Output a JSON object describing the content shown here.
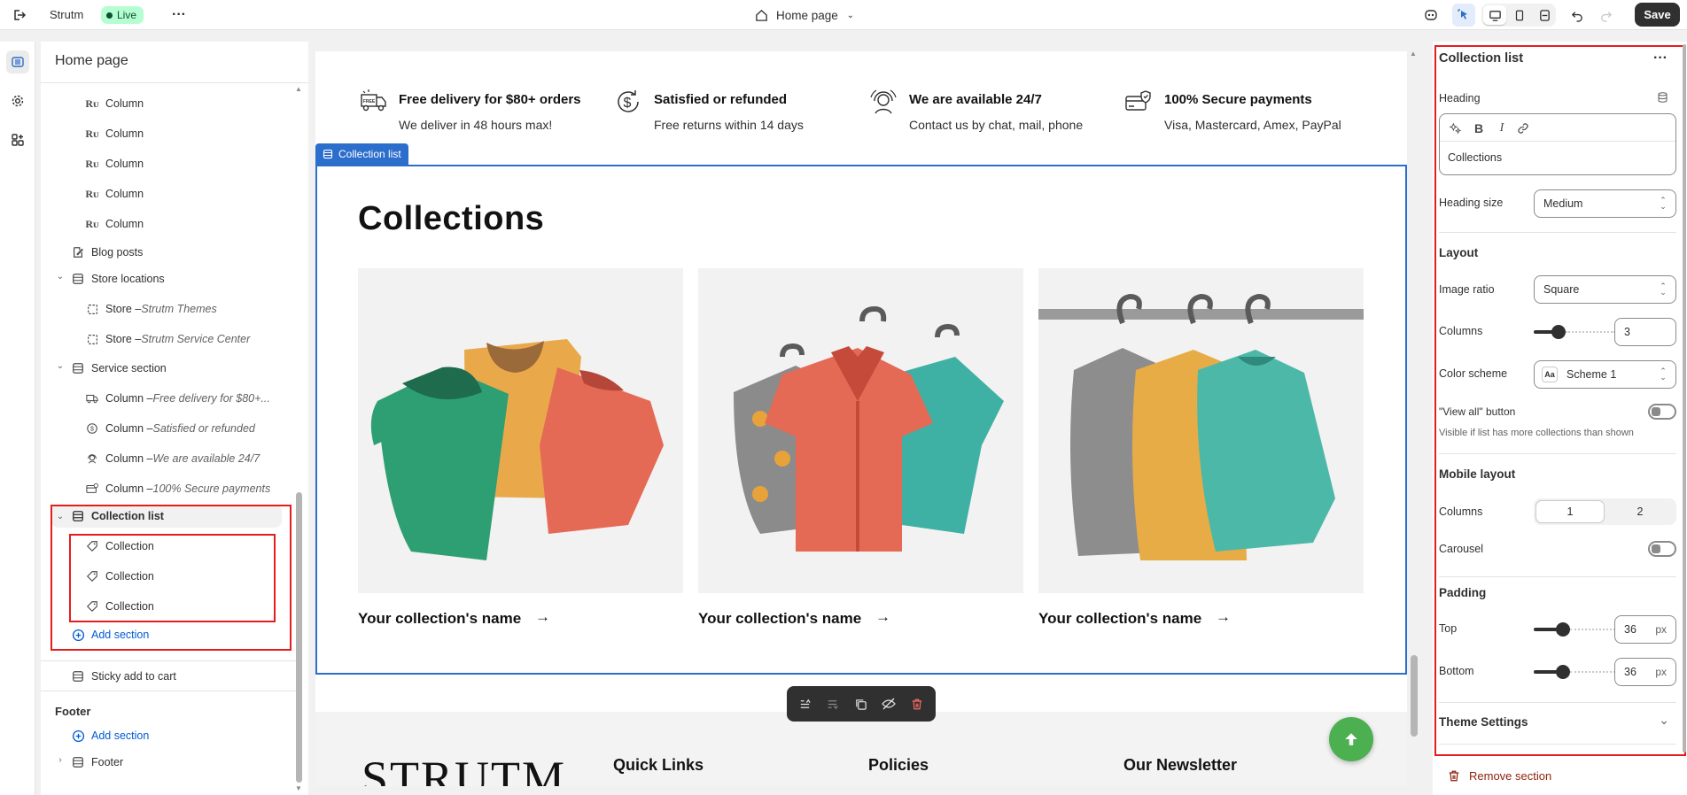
{
  "topbar": {
    "back_icon": "exit-icon",
    "store_name": "Strutm",
    "status_badge": "Live",
    "page_selector": "Home page",
    "save_label": "Save"
  },
  "sidebar": {
    "title": "Home page",
    "items": [
      {
        "label": "Column"
      },
      {
        "label": "Column"
      },
      {
        "label": "Column"
      },
      {
        "label": "Column"
      },
      {
        "label": "Column"
      },
      {
        "label": "Blog posts"
      },
      {
        "label": "Store locations"
      },
      {
        "label": "Store – ",
        "italic": "Strutm Themes"
      },
      {
        "label": "Store – ",
        "italic": "Strutm Service Center"
      },
      {
        "label": "Service section"
      },
      {
        "label": "Column – ",
        "italic": "Free delivery for $80+..."
      },
      {
        "label": "Column – ",
        "italic": "Satisfied or refunded"
      },
      {
        "label": "Column – ",
        "italic": "We are available 24/7"
      },
      {
        "label": "Column – ",
        "italic": "100% Secure payments"
      },
      {
        "label": "Collection list"
      },
      {
        "label": "Collection"
      },
      {
        "label": "Collection"
      },
      {
        "label": "Collection"
      },
      {
        "label": "Add section"
      },
      {
        "label": "Sticky add to cart"
      }
    ],
    "footer_heading": "Footer",
    "footer_add": "Add section",
    "footer_item": "Footer"
  },
  "preview": {
    "services": [
      {
        "title": "Free delivery for $80+ orders",
        "text": "We deliver in 48 hours max!",
        "icon": "delivery-truck-icon"
      },
      {
        "title": "Satisfied or refunded",
        "text": "Free returns within 14 days",
        "icon": "dollar-refund-icon"
      },
      {
        "title": "We are available 24/7",
        "text": "Contact us by chat, mail, phone",
        "icon": "support-agent-icon"
      },
      {
        "title": "100% Secure payments",
        "text": "Visa, Mastercard, Amex, PayPal",
        "icon": "secure-card-icon"
      }
    ],
    "section_tag": "Collection list",
    "heading": "Collections",
    "collections": [
      {
        "name": "Your collection's name"
      },
      {
        "name": "Your collection's name"
      },
      {
        "name": "Your collection's name"
      }
    ],
    "footer": {
      "logo": "STRUTM",
      "col1": "Quick Links",
      "col2": "Policies",
      "col3": "Our Newsletter"
    }
  },
  "inspector": {
    "title": "Collection list",
    "heading_label": "Heading",
    "heading_value": "Collections",
    "heading_size_label": "Heading size",
    "heading_size_value": "Medium",
    "layout_title": "Layout",
    "image_ratio_label": "Image ratio",
    "image_ratio_value": "Square",
    "columns_label": "Columns",
    "columns_value": "3",
    "columns_fraction": 0.3,
    "color_scheme_label": "Color scheme",
    "color_scheme_value": "Scheme 1",
    "view_all_label": "\"View all\" button",
    "view_all_help": "Visible if list has more collections than shown",
    "mobile_title": "Mobile layout",
    "mobile_columns_label": "Columns",
    "mobile_col_options": [
      "1",
      "2"
    ],
    "carousel_label": "Carousel",
    "padding_title": "Padding",
    "top_label": "Top",
    "top_value": "36",
    "top_fraction": 0.36,
    "bottom_label": "Bottom",
    "bottom_value": "36",
    "bottom_fraction": 0.36,
    "unit": "px",
    "theme_settings": "Theme Settings",
    "remove_label": "Remove section"
  },
  "colors": {
    "accent": "#2c6ecb",
    "highlight": "#e51c1c",
    "live": "#b4fed2",
    "fab": "#4caf50",
    "remove": "#8e1f0b"
  }
}
